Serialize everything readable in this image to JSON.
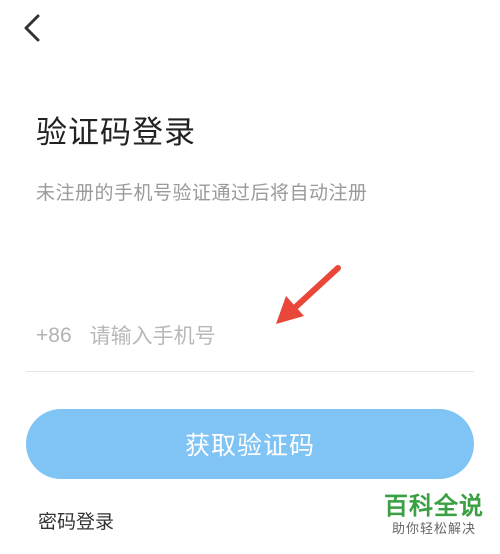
{
  "header": {
    "back_icon": "chevron-left-icon"
  },
  "login": {
    "title": "验证码登录",
    "subtitle": "未注册的手机号验证通过后将自动注册",
    "country_code": "+86",
    "phone_placeholder": "请输入手机号",
    "phone_value": "",
    "get_code_label": "获取验证码",
    "password_login_label": "密码登录"
  },
  "watermark": {
    "main": "百科全说",
    "sub": "助你轻松解决"
  },
  "colors": {
    "button_bg": "#7fc4f5",
    "arrow": "#e8473a",
    "watermark_green": "#3aa043"
  }
}
